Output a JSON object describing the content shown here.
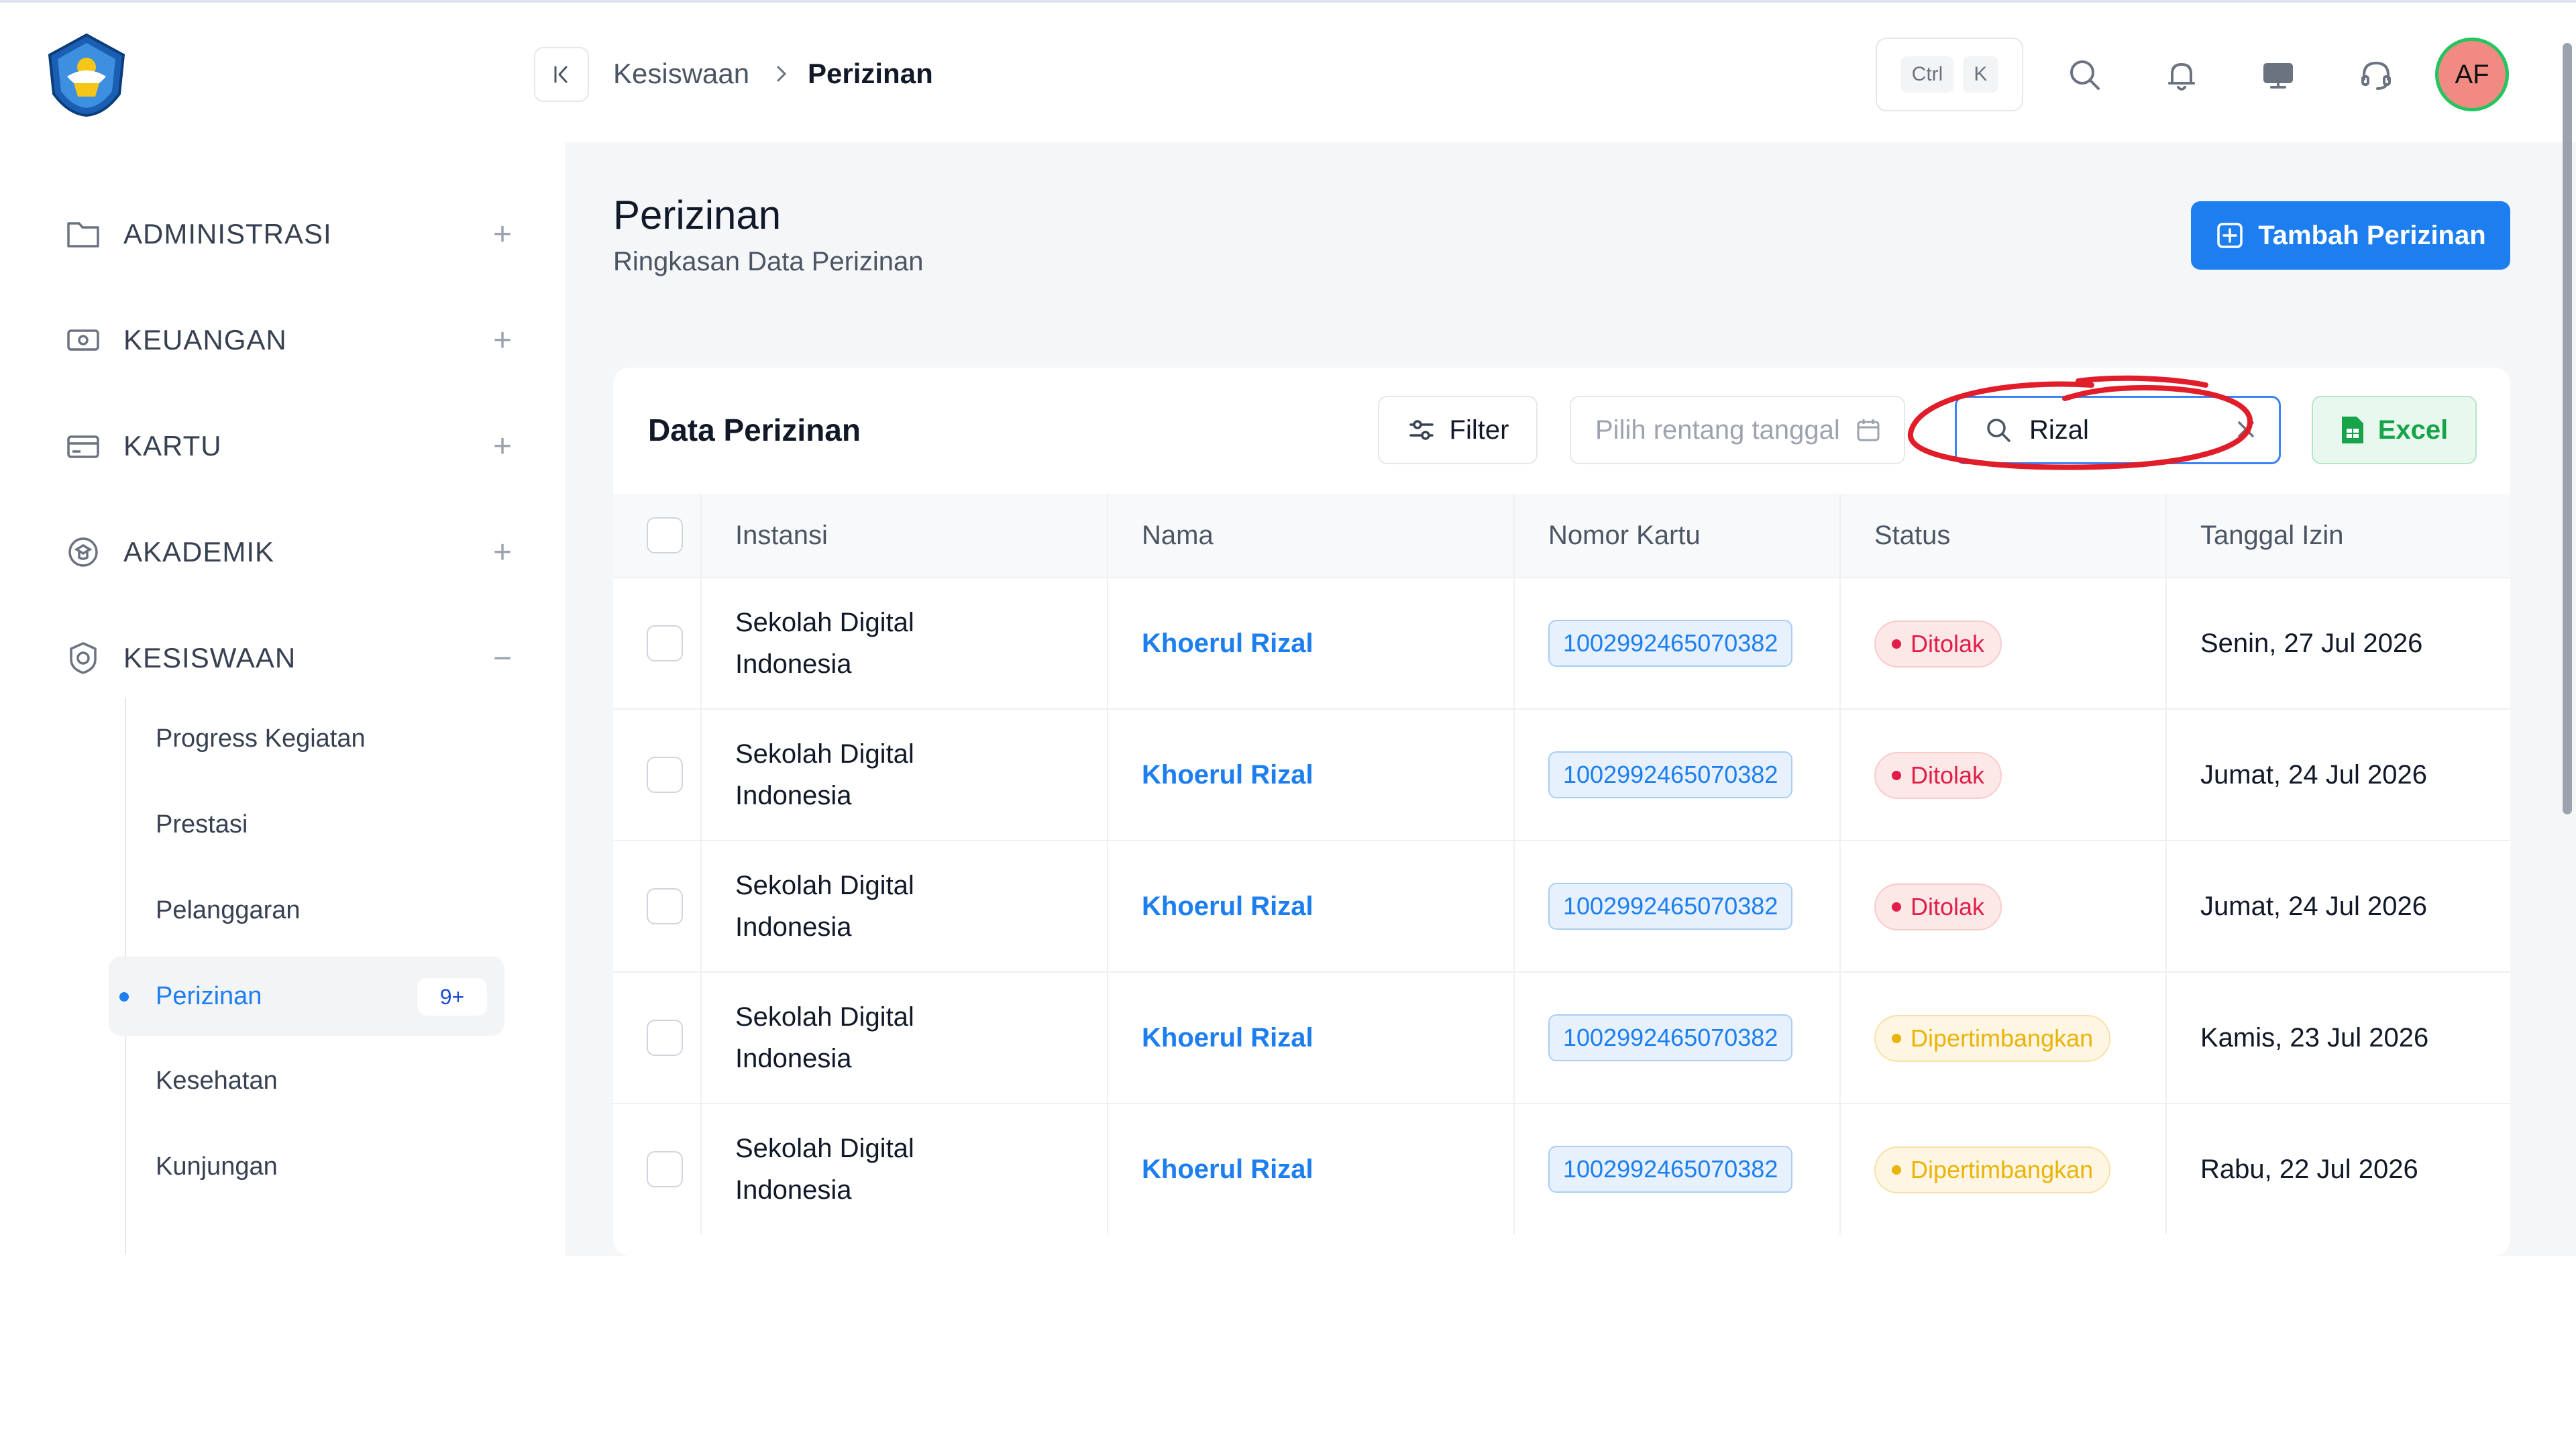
{
  "header": {
    "breadcrumb": [
      "Kesiswaan",
      "Perizinan"
    ],
    "shortcut_keys": [
      "Ctrl",
      "K"
    ],
    "avatar_initials": "AF",
    "icons": [
      "collapse-sidebar-icon",
      "search-icon",
      "bell-icon",
      "monitor-icon",
      "headset-icon"
    ]
  },
  "sidebar": {
    "sections": [
      {
        "label": "ADMINISTRASI",
        "icon": "folder-icon",
        "toggle": "+"
      },
      {
        "label": "KEUANGAN",
        "icon": "money-icon",
        "toggle": "+"
      },
      {
        "label": "KARTU",
        "icon": "card-icon",
        "toggle": "+"
      },
      {
        "label": "AKADEMIK",
        "icon": "academic-icon",
        "toggle": "+"
      },
      {
        "label": "KESISWAAN",
        "icon": "student-icon",
        "toggle": "−"
      }
    ],
    "subitems": [
      "Progress Kegiatan",
      "Prestasi",
      "Pelanggaran",
      "Perizinan",
      "Kesehatan",
      "Kunjungan"
    ],
    "active_subitem": "Perizinan",
    "active_badge": "9+"
  },
  "page": {
    "title": "Perizinan",
    "subtitle": "Ringkasan Data Perizinan",
    "add_button": "Tambah Perizinan"
  },
  "card": {
    "title": "Data Perizinan",
    "filter_label": "Filter",
    "date_placeholder": "Pilih rentang tanggal",
    "search_value": "Rizal",
    "excel_label": "Excel"
  },
  "table": {
    "columns": [
      "Instansi",
      "Nama",
      "Nomor Kartu",
      "Status",
      "Tanggal Izin"
    ],
    "rows": [
      {
        "instansi": [
          "Sekolah Digital",
          "Indonesia"
        ],
        "nama": "Khoerul Rizal",
        "nomor": "1002992465070382",
        "status": "Ditolak",
        "tanggal": "Senin, 27 Jul 2026"
      },
      {
        "instansi": [
          "Sekolah Digital",
          "Indonesia"
        ],
        "nama": "Khoerul Rizal",
        "nomor": "1002992465070382",
        "status": "Ditolak",
        "tanggal": "Jumat, 24 Jul 2026"
      },
      {
        "instansi": [
          "Sekolah Digital",
          "Indonesia"
        ],
        "nama": "Khoerul Rizal",
        "nomor": "1002992465070382",
        "status": "Ditolak",
        "tanggal": "Jumat, 24 Jul 2026"
      },
      {
        "instansi": [
          "Sekolah Digital",
          "Indonesia"
        ],
        "nama": "Khoerul Rizal",
        "nomor": "1002992465070382",
        "status": "Dipertimbangkan",
        "tanggal": "Kamis, 23 Jul 2026"
      },
      {
        "instansi": [
          "Sekolah Digital",
          "Indonesia"
        ],
        "nama": "Khoerul Rizal",
        "nomor": "1002992465070382",
        "status": "Dipertimbangkan",
        "tanggal": "Rabu, 22 Jul 2026"
      }
    ]
  },
  "colors": {
    "primary": "#1d7ef0",
    "danger": "#e11d48",
    "warning": "#eab308",
    "success": "#16a34a",
    "annotation": "#e11d2a"
  }
}
